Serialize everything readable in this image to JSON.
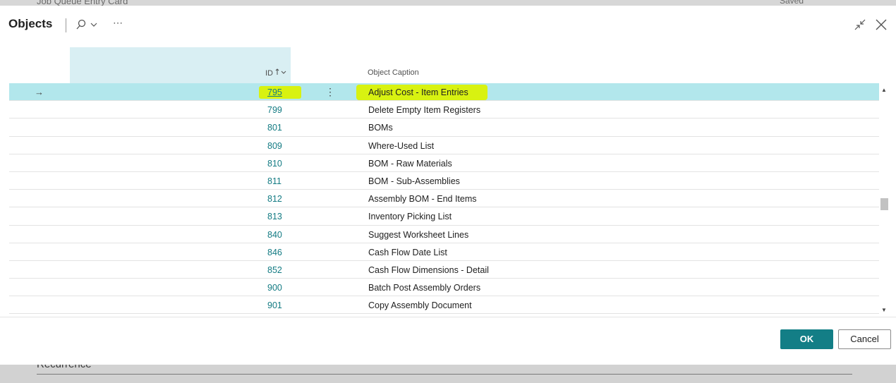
{
  "background": {
    "title": "Job Queue Entry Card",
    "saved": "Saved",
    "section": "Recurrence"
  },
  "modal": {
    "title": "Objects",
    "more_label": "⋯",
    "ok_label": "OK",
    "cancel_label": "Cancel"
  },
  "columns": {
    "id": "ID",
    "caption": "Object Caption"
  },
  "rows": [
    {
      "id": "795",
      "caption": "Adjust Cost - Item Entries",
      "selected": true
    },
    {
      "id": "799",
      "caption": "Delete Empty Item Registers"
    },
    {
      "id": "801",
      "caption": "BOMs"
    },
    {
      "id": "809",
      "caption": "Where-Used List"
    },
    {
      "id": "810",
      "caption": "BOM - Raw Materials"
    },
    {
      "id": "811",
      "caption": "BOM - Sub-Assemblies"
    },
    {
      "id": "812",
      "caption": "Assembly BOM - End Items"
    },
    {
      "id": "813",
      "caption": "Inventory Picking List"
    },
    {
      "id": "840",
      "caption": "Suggest Worksheet Lines"
    },
    {
      "id": "846",
      "caption": "Cash Flow Date List"
    },
    {
      "id": "852",
      "caption": "Cash Flow Dimensions - Detail"
    },
    {
      "id": "900",
      "caption": "Batch Post Assembly Orders"
    },
    {
      "id": "901",
      "caption": "Copy Assembly Document"
    }
  ],
  "colors": {
    "accent": "#137e86",
    "selected_row": "#b2e7ec",
    "highlighter": "#d8f211"
  }
}
